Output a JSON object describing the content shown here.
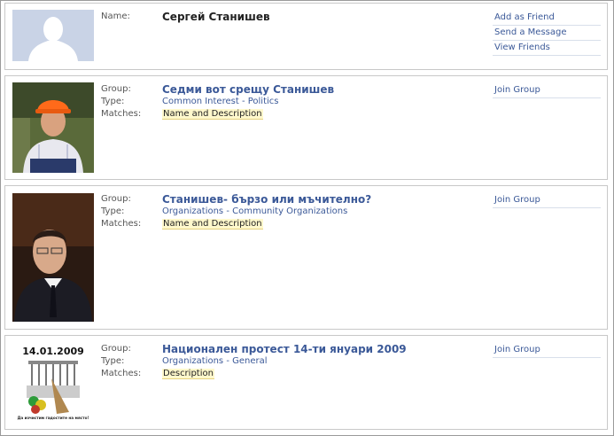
{
  "profile": {
    "name_label": "Name:",
    "name": "Сергей Станишев",
    "actions": [
      "Add as Friend",
      "Send a Message",
      "View Friends"
    ]
  },
  "labels": {
    "group": "Group:",
    "type": "Type:",
    "matches": "Matches:"
  },
  "results": [
    {
      "title": "Седми вот срещу Станишев",
      "type_a": "Common Interest",
      "type_b": "Politics",
      "matches": "Name and Description",
      "action": "Join Group"
    },
    {
      "title": "Станишев- бързо или мъчително?",
      "type_a": "Organizations",
      "type_b": "Community Organizations",
      "matches": "Name and Description",
      "action": "Join Group"
    },
    {
      "title": "Национален протест 14-ти януари 2009",
      "type_a": "Organizations",
      "type_b": "General",
      "matches": "Description",
      "action": "Join Group",
      "image_date": "14.01.2009",
      "image_caption": "Да изчистим гадостите на място!"
    }
  ],
  "separator": " - "
}
